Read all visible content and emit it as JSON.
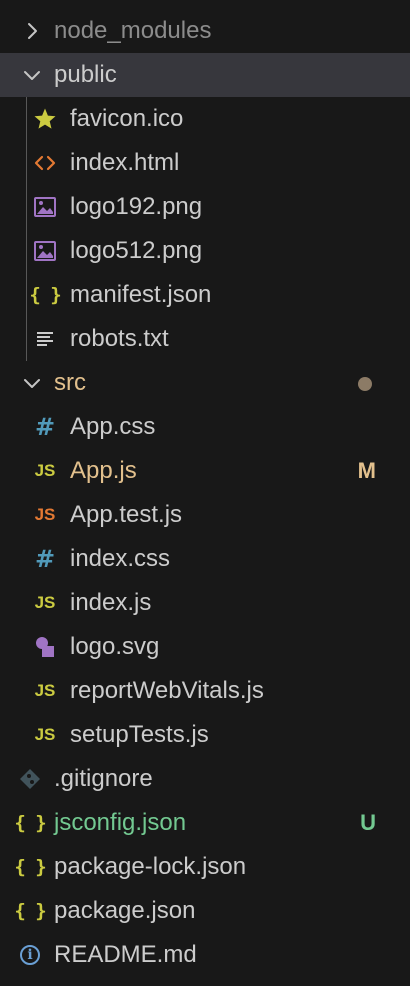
{
  "explorer": {
    "colors": {
      "default_text": "#cccccc",
      "folder_text": "#cccccc",
      "modified_text": "#e2c08d",
      "untracked_text": "#73c991",
      "dimmed_text": "#8c8c8c",
      "selected_background": "#37373d",
      "dot": "#8c7b66"
    },
    "items": [
      {
        "label": "node_modules",
        "kind": "folder",
        "expanded": false,
        "icon": "chevron-right-icon",
        "dimmed": true
      },
      {
        "label": "public",
        "kind": "folder",
        "expanded": true,
        "icon": "chevron-down-icon",
        "selected": true
      },
      {
        "label": "favicon.ico",
        "kind": "file",
        "icon": "star-icon"
      },
      {
        "label": "index.html",
        "kind": "file",
        "icon": "html-code-icon"
      },
      {
        "label": "logo192.png",
        "kind": "file",
        "icon": "image-icon"
      },
      {
        "label": "logo512.png",
        "kind": "file",
        "icon": "image-icon"
      },
      {
        "label": "manifest.json",
        "kind": "file",
        "icon": "json-braces-icon",
        "icon_text": "{ }"
      },
      {
        "label": "robots.txt",
        "kind": "file",
        "icon": "text-lines-icon"
      },
      {
        "label": "src",
        "kind": "folder",
        "expanded": true,
        "icon": "chevron-down-icon",
        "status": "modified-dot"
      },
      {
        "label": "App.css",
        "kind": "file",
        "icon": "css-hash-icon",
        "icon_text": "#"
      },
      {
        "label": "App.js",
        "kind": "file",
        "icon": "javascript-icon",
        "icon_text": "JS",
        "badge": "M",
        "status": "modified"
      },
      {
        "label": "App.test.js",
        "kind": "file",
        "icon": "javascript-test-icon",
        "icon_text": "JS"
      },
      {
        "label": "index.css",
        "kind": "file",
        "icon": "css-hash-icon",
        "icon_text": "#"
      },
      {
        "label": "index.js",
        "kind": "file",
        "icon": "javascript-icon",
        "icon_text": "JS"
      },
      {
        "label": "logo.svg",
        "kind": "file",
        "icon": "svg-image-icon"
      },
      {
        "label": "reportWebVitals.js",
        "kind": "file",
        "icon": "javascript-icon",
        "icon_text": "JS"
      },
      {
        "label": "setupTests.js",
        "kind": "file",
        "icon": "javascript-icon",
        "icon_text": "JS"
      },
      {
        "label": ".gitignore",
        "kind": "file",
        "icon": "git-diamond-icon"
      },
      {
        "label": "jsconfig.json",
        "kind": "file",
        "icon": "json-braces-icon",
        "icon_text": "{ }",
        "badge": "U",
        "status": "untracked"
      },
      {
        "label": "package-lock.json",
        "kind": "file",
        "icon": "json-braces-icon",
        "icon_text": "{ }"
      },
      {
        "label": "package.json",
        "kind": "file",
        "icon": "json-braces-icon",
        "icon_text": "{ }"
      },
      {
        "label": "README.md",
        "kind": "file",
        "icon": "info-icon",
        "icon_text": "i"
      }
    ]
  }
}
